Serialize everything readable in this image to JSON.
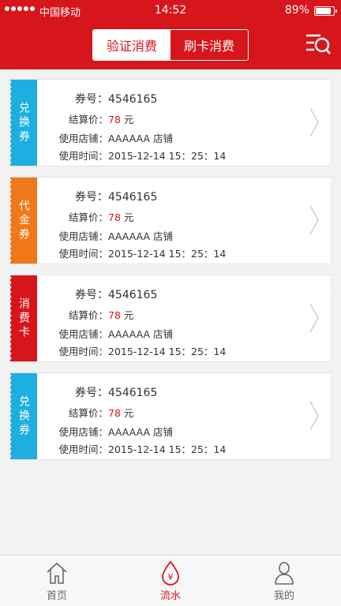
{
  "status_bar": {
    "carrier": "中国移动",
    "time": "14:52",
    "battery": "89%",
    "battery_level": 0.89
  },
  "header": {
    "tabs": [
      {
        "label": "验证消费",
        "active": true
      },
      {
        "label": "刷卡消费",
        "active": false
      }
    ],
    "filter_icon": "filter-search-icon"
  },
  "colors": {
    "brand": "#d7161c",
    "exchange": "#1eaee0",
    "voucher": "#f07818",
    "card": "#d7161c"
  },
  "cards": [
    {
      "tag": "兑换券",
      "tag_color": "#1eaee0",
      "coupon_label": "券号：",
      "coupon_no": "4546165",
      "price_label": "结算价：",
      "price": "78",
      "price_unit": "元",
      "store_label": "使用店铺：",
      "store": "AAAAAA 店铺",
      "time_label": "使用时间：",
      "time": "2015-12-14   15：25：14"
    },
    {
      "tag": "代金券",
      "tag_color": "#f07818",
      "coupon_label": "券号：",
      "coupon_no": "4546165",
      "price_label": "结算价：",
      "price": "78",
      "price_unit": "元",
      "store_label": "使用店铺：",
      "store": "AAAAAA 店铺",
      "time_label": "使用时间：",
      "time": "2015-12-14   15：25：14"
    },
    {
      "tag": "消费卡",
      "tag_color": "#d7161c",
      "coupon_label": "券号：",
      "coupon_no": "4546165",
      "price_label": "结算价：",
      "price": "78",
      "price_unit": "元",
      "store_label": "使用店铺：",
      "store": "AAAAAA 店铺",
      "time_label": "使用时间：",
      "time": "2015-12-14   15：25：14"
    },
    {
      "tag": "兑换券",
      "tag_color": "#1eaee0",
      "coupon_label": "券号：",
      "coupon_no": "4546165",
      "price_label": "结算价：",
      "price": "78",
      "price_unit": "元",
      "store_label": "使用店铺：",
      "store": "AAAAAA 店铺",
      "time_label": "使用时间：",
      "time": "2015-12-14   15：25：14"
    }
  ],
  "tabbar": {
    "items": [
      {
        "label": "首页",
        "icon": "home-icon",
        "active": false
      },
      {
        "label": "流水",
        "icon": "yuan-drop-icon",
        "active": true
      },
      {
        "label": "我的",
        "icon": "user-icon",
        "active": false
      }
    ]
  }
}
